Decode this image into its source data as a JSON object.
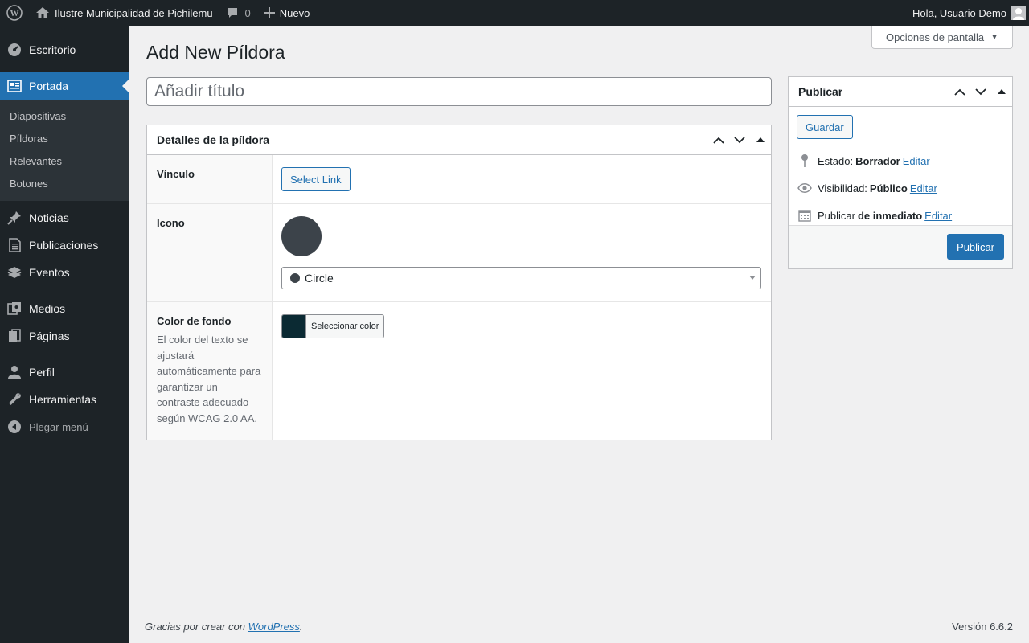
{
  "adminbar": {
    "site_name": "Ilustre Municipalidad de Pichilemu",
    "comments_count": "0",
    "new_label": "Nuevo",
    "greeting": "Hola, Usuario Demo"
  },
  "sidebar": {
    "items": [
      {
        "label": "Escritorio",
        "icon": "dashboard-icon"
      },
      {
        "label": "Portada",
        "icon": "portada-icon"
      },
      {
        "label": "Noticias",
        "icon": "pin-icon"
      },
      {
        "label": "Publicaciones",
        "icon": "document-icon"
      },
      {
        "label": "Eventos",
        "icon": "calendar-stack-icon"
      },
      {
        "label": "Medios",
        "icon": "media-icon"
      },
      {
        "label": "Páginas",
        "icon": "pages-icon"
      },
      {
        "label": "Perfil",
        "icon": "user-icon"
      },
      {
        "label": "Herramientas",
        "icon": "wrench-icon"
      }
    ],
    "submenu": [
      "Diapositivas",
      "Píldoras",
      "Relevantes",
      "Botones"
    ],
    "collapse_label": "Plegar menú"
  },
  "screen_options": "Opciones de pantalla",
  "page_title": "Add New Píldora",
  "title_placeholder": "Añadir título",
  "details": {
    "title": "Detalles de la píldora",
    "vinculo_label": "Vínculo",
    "select_link": "Select Link",
    "icono_label": "Icono",
    "icon_select_value": "Circle",
    "color_label": "Color de fondo",
    "color_desc": "El color del texto se ajustará automáticamente para garantizar un contraste adecuado según WCAG 2.0 AA.",
    "color_button": "Seleccionar color",
    "color_value": "#0b2a33"
  },
  "publish": {
    "title": "Publicar",
    "save_label": "Guardar",
    "status_prefix": "Estado:",
    "status_value": "Borrador",
    "visibility_prefix": "Visibilidad:",
    "visibility_value": "Público",
    "schedule_prefix": "Publicar",
    "schedule_value": "de inmediato",
    "edit_link": "Editar",
    "publish_button": "Publicar"
  },
  "footer": {
    "thanks_prefix": "Gracias por crear con ",
    "thanks_link": "WordPress",
    "thanks_suffix": ".",
    "version": "Versión 6.6.2"
  },
  "colors": {
    "accent": "#2271b1",
    "sidebar_bg": "#1d2327",
    "submenu_bg": "#2c3338",
    "page_bg": "#f0f0f1"
  }
}
